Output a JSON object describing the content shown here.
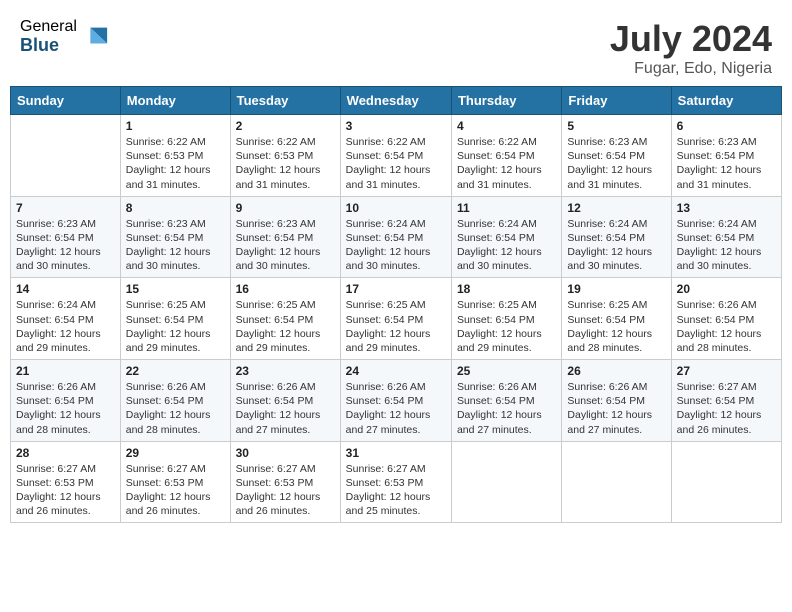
{
  "header": {
    "logo_general": "General",
    "logo_blue": "Blue",
    "month_year": "July 2024",
    "location": "Fugar, Edo, Nigeria"
  },
  "days_of_week": [
    "Sunday",
    "Monday",
    "Tuesday",
    "Wednesday",
    "Thursday",
    "Friday",
    "Saturday"
  ],
  "weeks": [
    [
      {
        "num": "",
        "info": ""
      },
      {
        "num": "1",
        "info": "Sunrise: 6:22 AM\nSunset: 6:53 PM\nDaylight: 12 hours\nand 31 minutes."
      },
      {
        "num": "2",
        "info": "Sunrise: 6:22 AM\nSunset: 6:53 PM\nDaylight: 12 hours\nand 31 minutes."
      },
      {
        "num": "3",
        "info": "Sunrise: 6:22 AM\nSunset: 6:54 PM\nDaylight: 12 hours\nand 31 minutes."
      },
      {
        "num": "4",
        "info": "Sunrise: 6:22 AM\nSunset: 6:54 PM\nDaylight: 12 hours\nand 31 minutes."
      },
      {
        "num": "5",
        "info": "Sunrise: 6:23 AM\nSunset: 6:54 PM\nDaylight: 12 hours\nand 31 minutes."
      },
      {
        "num": "6",
        "info": "Sunrise: 6:23 AM\nSunset: 6:54 PM\nDaylight: 12 hours\nand 31 minutes."
      }
    ],
    [
      {
        "num": "7",
        "info": "Sunrise: 6:23 AM\nSunset: 6:54 PM\nDaylight: 12 hours\nand 30 minutes."
      },
      {
        "num": "8",
        "info": "Sunrise: 6:23 AM\nSunset: 6:54 PM\nDaylight: 12 hours\nand 30 minutes."
      },
      {
        "num": "9",
        "info": "Sunrise: 6:23 AM\nSunset: 6:54 PM\nDaylight: 12 hours\nand 30 minutes."
      },
      {
        "num": "10",
        "info": "Sunrise: 6:24 AM\nSunset: 6:54 PM\nDaylight: 12 hours\nand 30 minutes."
      },
      {
        "num": "11",
        "info": "Sunrise: 6:24 AM\nSunset: 6:54 PM\nDaylight: 12 hours\nand 30 minutes."
      },
      {
        "num": "12",
        "info": "Sunrise: 6:24 AM\nSunset: 6:54 PM\nDaylight: 12 hours\nand 30 minutes."
      },
      {
        "num": "13",
        "info": "Sunrise: 6:24 AM\nSunset: 6:54 PM\nDaylight: 12 hours\nand 30 minutes."
      }
    ],
    [
      {
        "num": "14",
        "info": "Sunrise: 6:24 AM\nSunset: 6:54 PM\nDaylight: 12 hours\nand 29 minutes."
      },
      {
        "num": "15",
        "info": "Sunrise: 6:25 AM\nSunset: 6:54 PM\nDaylight: 12 hours\nand 29 minutes."
      },
      {
        "num": "16",
        "info": "Sunrise: 6:25 AM\nSunset: 6:54 PM\nDaylight: 12 hours\nand 29 minutes."
      },
      {
        "num": "17",
        "info": "Sunrise: 6:25 AM\nSunset: 6:54 PM\nDaylight: 12 hours\nand 29 minutes."
      },
      {
        "num": "18",
        "info": "Sunrise: 6:25 AM\nSunset: 6:54 PM\nDaylight: 12 hours\nand 29 minutes."
      },
      {
        "num": "19",
        "info": "Sunrise: 6:25 AM\nSunset: 6:54 PM\nDaylight: 12 hours\nand 28 minutes."
      },
      {
        "num": "20",
        "info": "Sunrise: 6:26 AM\nSunset: 6:54 PM\nDaylight: 12 hours\nand 28 minutes."
      }
    ],
    [
      {
        "num": "21",
        "info": "Sunrise: 6:26 AM\nSunset: 6:54 PM\nDaylight: 12 hours\nand 28 minutes."
      },
      {
        "num": "22",
        "info": "Sunrise: 6:26 AM\nSunset: 6:54 PM\nDaylight: 12 hours\nand 28 minutes."
      },
      {
        "num": "23",
        "info": "Sunrise: 6:26 AM\nSunset: 6:54 PM\nDaylight: 12 hours\nand 27 minutes."
      },
      {
        "num": "24",
        "info": "Sunrise: 6:26 AM\nSunset: 6:54 PM\nDaylight: 12 hours\nand 27 minutes."
      },
      {
        "num": "25",
        "info": "Sunrise: 6:26 AM\nSunset: 6:54 PM\nDaylight: 12 hours\nand 27 minutes."
      },
      {
        "num": "26",
        "info": "Sunrise: 6:26 AM\nSunset: 6:54 PM\nDaylight: 12 hours\nand 27 minutes."
      },
      {
        "num": "27",
        "info": "Sunrise: 6:27 AM\nSunset: 6:54 PM\nDaylight: 12 hours\nand 26 minutes."
      }
    ],
    [
      {
        "num": "28",
        "info": "Sunrise: 6:27 AM\nSunset: 6:53 PM\nDaylight: 12 hours\nand 26 minutes."
      },
      {
        "num": "29",
        "info": "Sunrise: 6:27 AM\nSunset: 6:53 PM\nDaylight: 12 hours\nand 26 minutes."
      },
      {
        "num": "30",
        "info": "Sunrise: 6:27 AM\nSunset: 6:53 PM\nDaylight: 12 hours\nand 26 minutes."
      },
      {
        "num": "31",
        "info": "Sunrise: 6:27 AM\nSunset: 6:53 PM\nDaylight: 12 hours\nand 25 minutes."
      },
      {
        "num": "",
        "info": ""
      },
      {
        "num": "",
        "info": ""
      },
      {
        "num": "",
        "info": ""
      }
    ]
  ]
}
